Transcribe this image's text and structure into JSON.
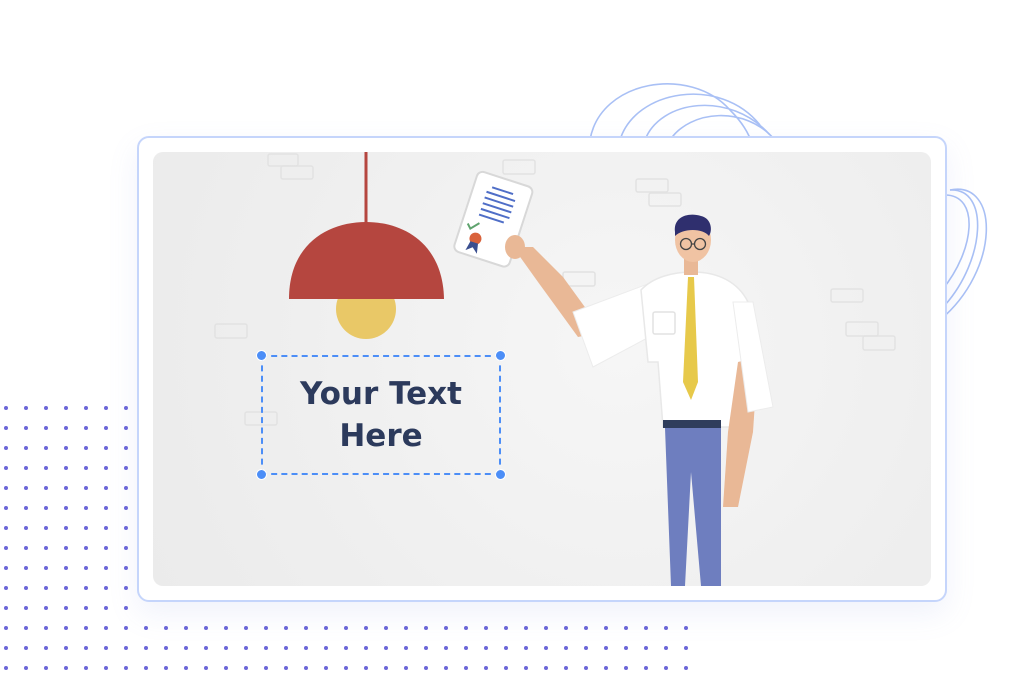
{
  "text_box": {
    "content": "Your Text\nHere"
  },
  "colors": {
    "frame_border": "#c5d5fb",
    "selection": "#4c8ef7",
    "heading_text": "#2c3a5c",
    "dots": "#6b66d8",
    "lamp": "#b5463f",
    "tie": "#e7c94a",
    "pants": "#6e7ebf"
  },
  "icons": {
    "lamp": "pendant-lamp-icon",
    "certificate": "certificate-scroll-icon",
    "character": "presenter-character-illustration"
  }
}
